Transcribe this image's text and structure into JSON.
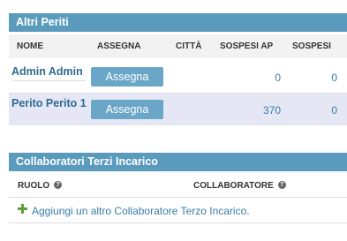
{
  "altri_periti": {
    "title": "Altri Periti",
    "columns": [
      "NOME",
      "ASSEGNA",
      "CITTÀ",
      "SOSPESI AP",
      "SOSPESI"
    ],
    "rows": [
      {
        "nome": "Admin Admin",
        "button": "Assegna",
        "citta": "",
        "sospesi_ap": "0",
        "sospesi": "0"
      },
      {
        "nome": "Perito Perito 1",
        "button": "Assegna",
        "citta": "",
        "sospesi_ap": "370",
        "sospesi": "0"
      }
    ]
  },
  "collaboratori": {
    "title": "Collaboratori Terzi Incarico",
    "columns": [
      "RUOLO",
      "COLLABORATORE"
    ],
    "help_icon": "?",
    "add_link": "Aggiungi un altro Collaboratore Terzo Incarico."
  },
  "colors": {
    "header_bg": "#5a9bbd",
    "button_bg": "#6aa6c7",
    "alt_row_bg": "#e5e7f5",
    "link": "#3a7ca5",
    "plus": "#5aa03a"
  },
  "icons": [
    "question-circle-icon",
    "plus-icon"
  ]
}
